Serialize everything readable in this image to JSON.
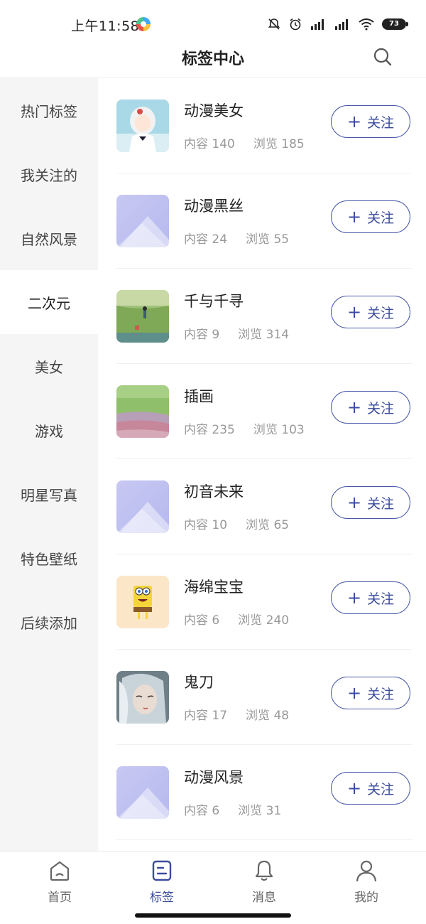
{
  "status_bar": {
    "time": "上午11:58",
    "battery": "73"
  },
  "header": {
    "title": "标签中心",
    "search_icon": "search-icon"
  },
  "sidebar": {
    "items": [
      {
        "label": "热门标签",
        "active": false
      },
      {
        "label": "我关注的",
        "active": false
      },
      {
        "label": "自然风景",
        "active": false
      },
      {
        "label": "二次元",
        "active": true
      },
      {
        "label": "美女",
        "active": false
      },
      {
        "label": "游戏",
        "active": false
      },
      {
        "label": "明星写真",
        "active": false
      },
      {
        "label": "特色壁纸",
        "active": false
      },
      {
        "label": "后续添加",
        "active": false
      }
    ]
  },
  "tags": [
    {
      "name": "动漫美女",
      "content_label": "内容",
      "content": "140",
      "views_label": "浏览",
      "views": "185",
      "thumb": "anime-girl-image",
      "follow_label": "关注"
    },
    {
      "name": "动漫黑丝",
      "content_label": "内容",
      "content": "24",
      "views_label": "浏览",
      "views": "55",
      "thumb": "placeholder-image",
      "follow_label": "关注"
    },
    {
      "name": "千与千寻",
      "content_label": "内容",
      "content": "9",
      "views_label": "浏览",
      "views": "314",
      "thumb": "field-scene-image",
      "follow_label": "关注"
    },
    {
      "name": "插画",
      "content_label": "内容",
      "content": "235",
      "views_label": "浏览",
      "views": "103",
      "thumb": "landscape-illustration-image",
      "follow_label": "关注"
    },
    {
      "name": "初音未来",
      "content_label": "内容",
      "content": "10",
      "views_label": "浏览",
      "views": "65",
      "thumb": "placeholder-image",
      "follow_label": "关注"
    },
    {
      "name": "海绵宝宝",
      "content_label": "内容",
      "content": "6",
      "views_label": "浏览",
      "views": "240",
      "thumb": "spongebob-image",
      "follow_label": "关注"
    },
    {
      "name": "鬼刀",
      "content_label": "内容",
      "content": "17",
      "views_label": "浏览",
      "views": "48",
      "thumb": "portrait-image",
      "follow_label": "关注"
    },
    {
      "name": "动漫风景",
      "content_label": "内容",
      "content": "6",
      "views_label": "浏览",
      "views": "31",
      "thumb": "placeholder-image",
      "follow_label": "关注"
    }
  ],
  "bottom_nav": {
    "items": [
      {
        "label": "首页",
        "icon": "home-icon",
        "active": false
      },
      {
        "label": "标签",
        "icon": "tag-icon",
        "active": true
      },
      {
        "label": "消息",
        "icon": "bell-icon",
        "active": false
      },
      {
        "label": "我的",
        "icon": "user-icon",
        "active": false
      }
    ]
  },
  "colors": {
    "accent": "#3b4c9c",
    "sidebar_bg": "#f5f5f5",
    "placeholder": "#c7c8f2"
  }
}
